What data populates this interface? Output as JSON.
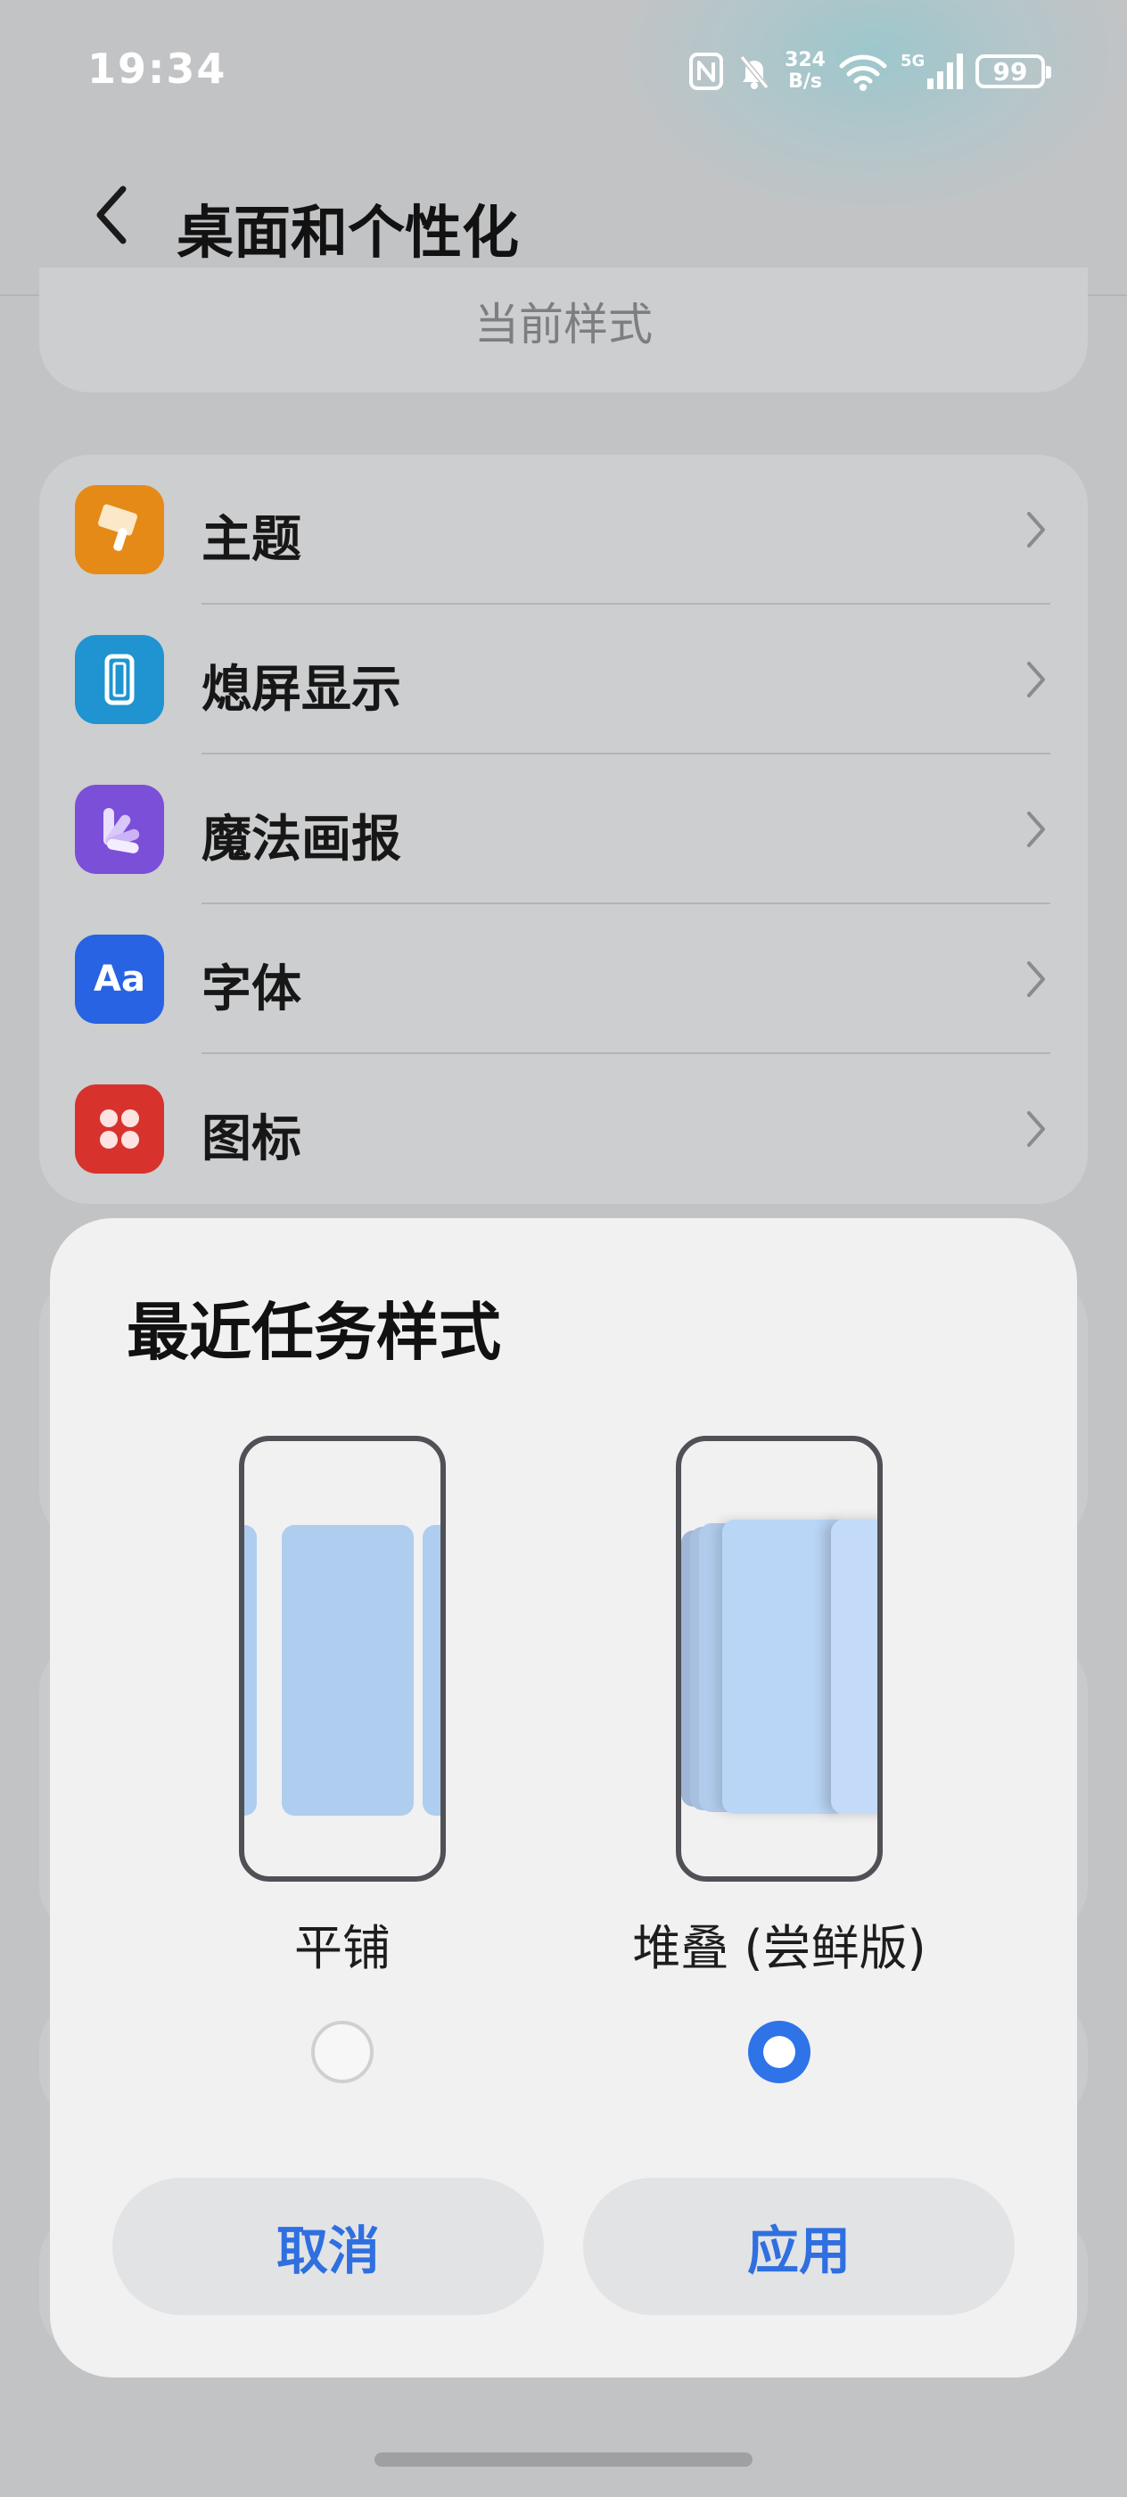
{
  "status_bar": {
    "time": "19:34",
    "net_speed_value": "324",
    "net_speed_unit": "B/s",
    "battery": "99",
    "icons": [
      "nfc-icon",
      "mute-bell-icon",
      "wifi-icon",
      "signal-5g-icon",
      "battery-icon"
    ]
  },
  "header": {
    "title": "桌面和个性化",
    "back_icon": "chevron-left-icon"
  },
  "current_card": {
    "label": "当前样式"
  },
  "menu": {
    "items": [
      {
        "label": "主题",
        "icon": "paint-brush-icon",
        "color": "#e58a17"
      },
      {
        "label": "熄屏显示",
        "icon": "phone-outline-icon",
        "color": "#1f94d1"
      },
      {
        "label": "魔法画报",
        "icon": "fan-petals-icon",
        "color": "#7b4fd8"
      },
      {
        "label": "字体",
        "icon": "font-aa-icon",
        "color": "#2763e2"
      },
      {
        "label": "图标",
        "icon": "four-dots-icon",
        "color": "#d8322d"
      }
    ]
  },
  "dialog": {
    "title": "最近任务样式",
    "options": [
      {
        "label": "平铺",
        "selected": false
      },
      {
        "label": "堆叠 (尝鲜版)",
        "selected": true
      }
    ],
    "cancel": "取消",
    "apply": "应用",
    "accent": "#2e73e8"
  }
}
